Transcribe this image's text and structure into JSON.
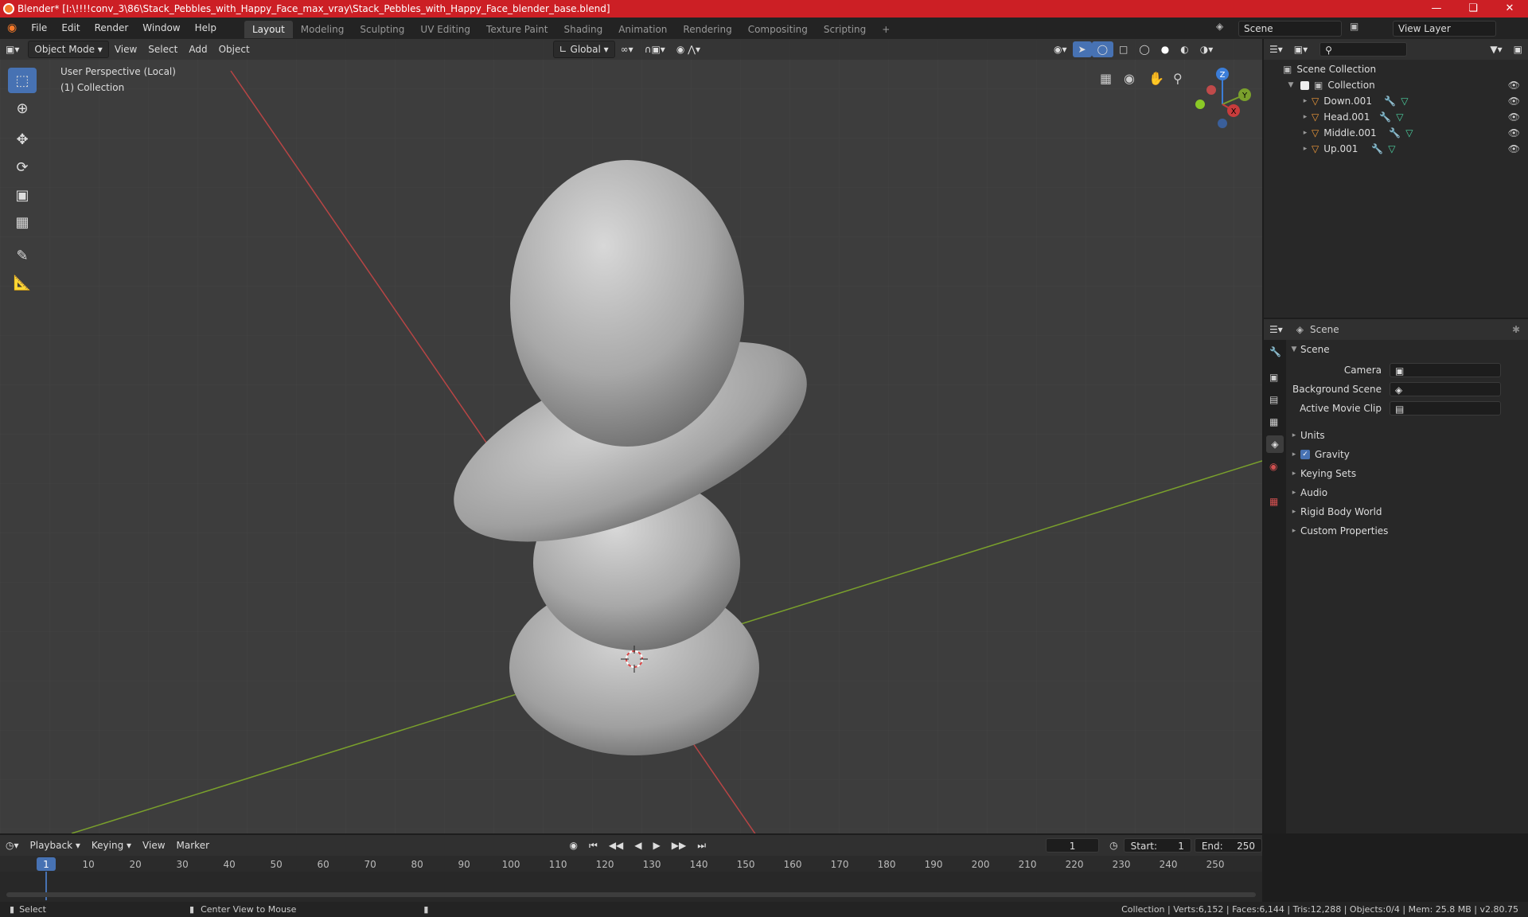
{
  "window": {
    "title": "Blender* [I:\\!!!!conv_3\\86\\Stack_Pebbles_with_Happy_Face_max_vray\\Stack_Pebbles_with_Happy_Face_blender_base.blend]"
  },
  "menu": {
    "file": "File",
    "edit": "Edit",
    "render": "Render",
    "window": "Window",
    "help": "Help"
  },
  "workspaces": [
    "Layout",
    "Modeling",
    "Sculpting",
    "UV Editing",
    "Texture Paint",
    "Shading",
    "Animation",
    "Rendering",
    "Compositing",
    "Scripting"
  ],
  "scene_field": "Scene",
  "view_layer_field": "View Layer",
  "viewport": {
    "mode": "Object Mode",
    "view": "View",
    "select": "Select",
    "add": "Add",
    "object": "Object",
    "orientation": "Global",
    "perspective": "User Perspective (Local)",
    "collection": "(1) Collection",
    "gizmo": {
      "z": "Z",
      "y": "Y",
      "x": "X"
    }
  },
  "outliner": {
    "root": "Scene Collection",
    "collection": "Collection",
    "items": [
      "Down.001",
      "Head.001",
      "Middle.001",
      "Up.001"
    ]
  },
  "properties": {
    "header": "Scene",
    "panel": "Scene",
    "camera_label": "Camera",
    "bg_scene_label": "Background Scene",
    "movie_clip_label": "Active Movie Clip",
    "sections": [
      "Units",
      "Gravity",
      "Keying Sets",
      "Audio",
      "Rigid Body World",
      "Custom Properties"
    ]
  },
  "timeline": {
    "playback": "Playback",
    "keying": "Keying",
    "view": "View",
    "marker": "Marker",
    "current_frame": "1",
    "start_label": "Start:",
    "start": "1",
    "end_label": "End:",
    "end": "250",
    "ticks": [
      "1",
      "10",
      "20",
      "30",
      "40",
      "50",
      "60",
      "70",
      "80",
      "90",
      "100",
      "110",
      "120",
      "130",
      "140",
      "150",
      "160",
      "170",
      "180",
      "190",
      "200",
      "210",
      "220",
      "230",
      "240",
      "250"
    ]
  },
  "status": {
    "select": "Select",
    "center": "Center View to Mouse",
    "stats": "Collection | Verts:6,152 | Faces:6,144 | Tris:12,288 | Objects:0/4 | Mem: 25.8 MB | v2.80.75"
  },
  "colors": {
    "accent": "#4772b3",
    "titlebar": "#cc1f25",
    "x_axis": "#c83c3c",
    "y_axis": "#7aa02c"
  }
}
